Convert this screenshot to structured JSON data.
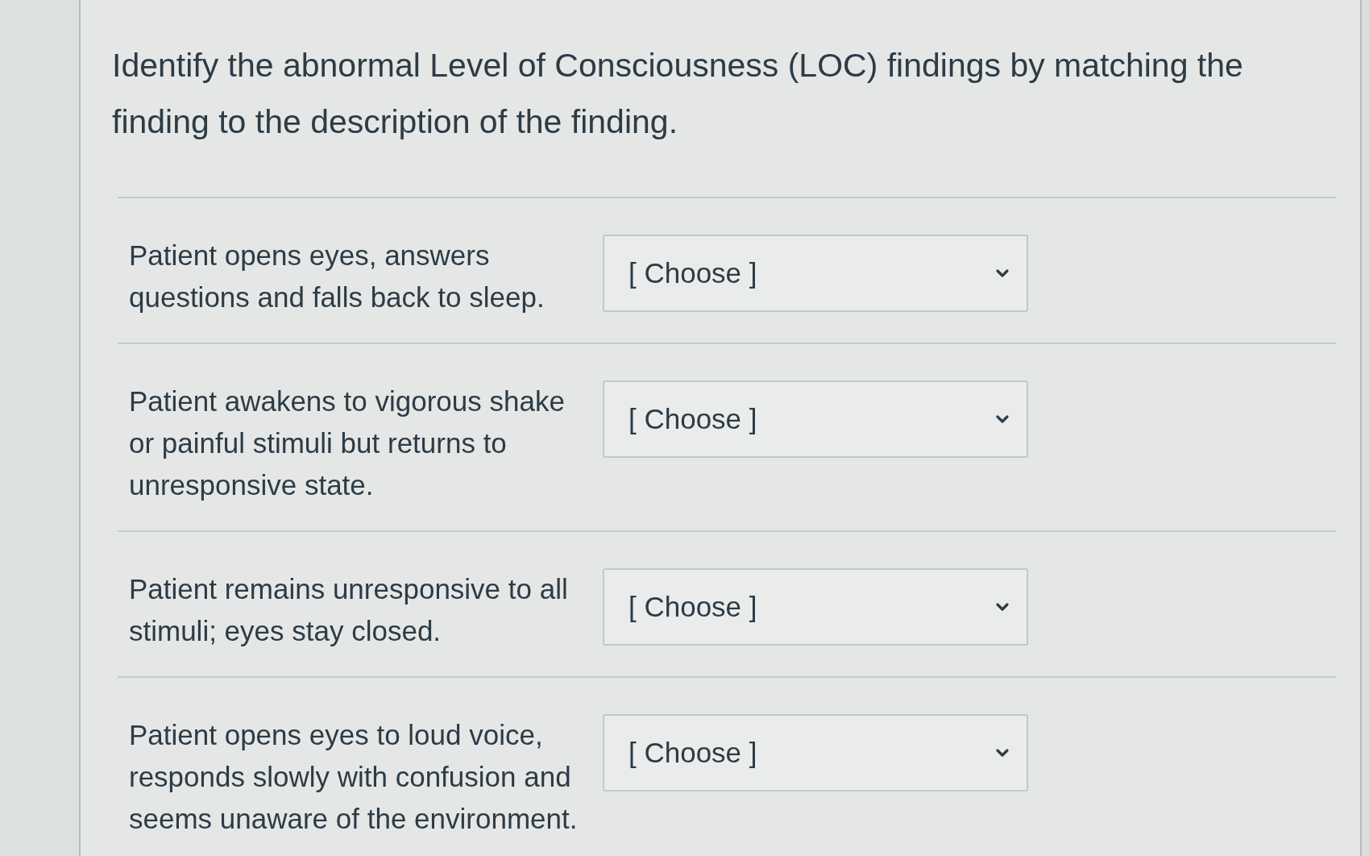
{
  "question": {
    "prompt": "Identify the abnormal Level of Consciousness (LOC) findings by matching the finding to the description of the finding."
  },
  "matches": [
    {
      "description": "Patient opens eyes, answers questions and falls back to sleep.",
      "answer": {
        "value": "[ Choose ]"
      }
    },
    {
      "description": "Patient awakens to vigorous shake or painful stimuli but returns to unresponsive state.",
      "answer": {
        "value": "[ Choose ]"
      }
    },
    {
      "description": "Patient remains unresponsive to all stimuli; eyes stay closed.",
      "answer": {
        "value": "[ Choose ]"
      }
    },
    {
      "description": "Patient opens eyes to loud voice, responds slowly with confusion and seems unaware of the environment.",
      "answer": {
        "value": "[ Choose ]"
      }
    }
  ]
}
